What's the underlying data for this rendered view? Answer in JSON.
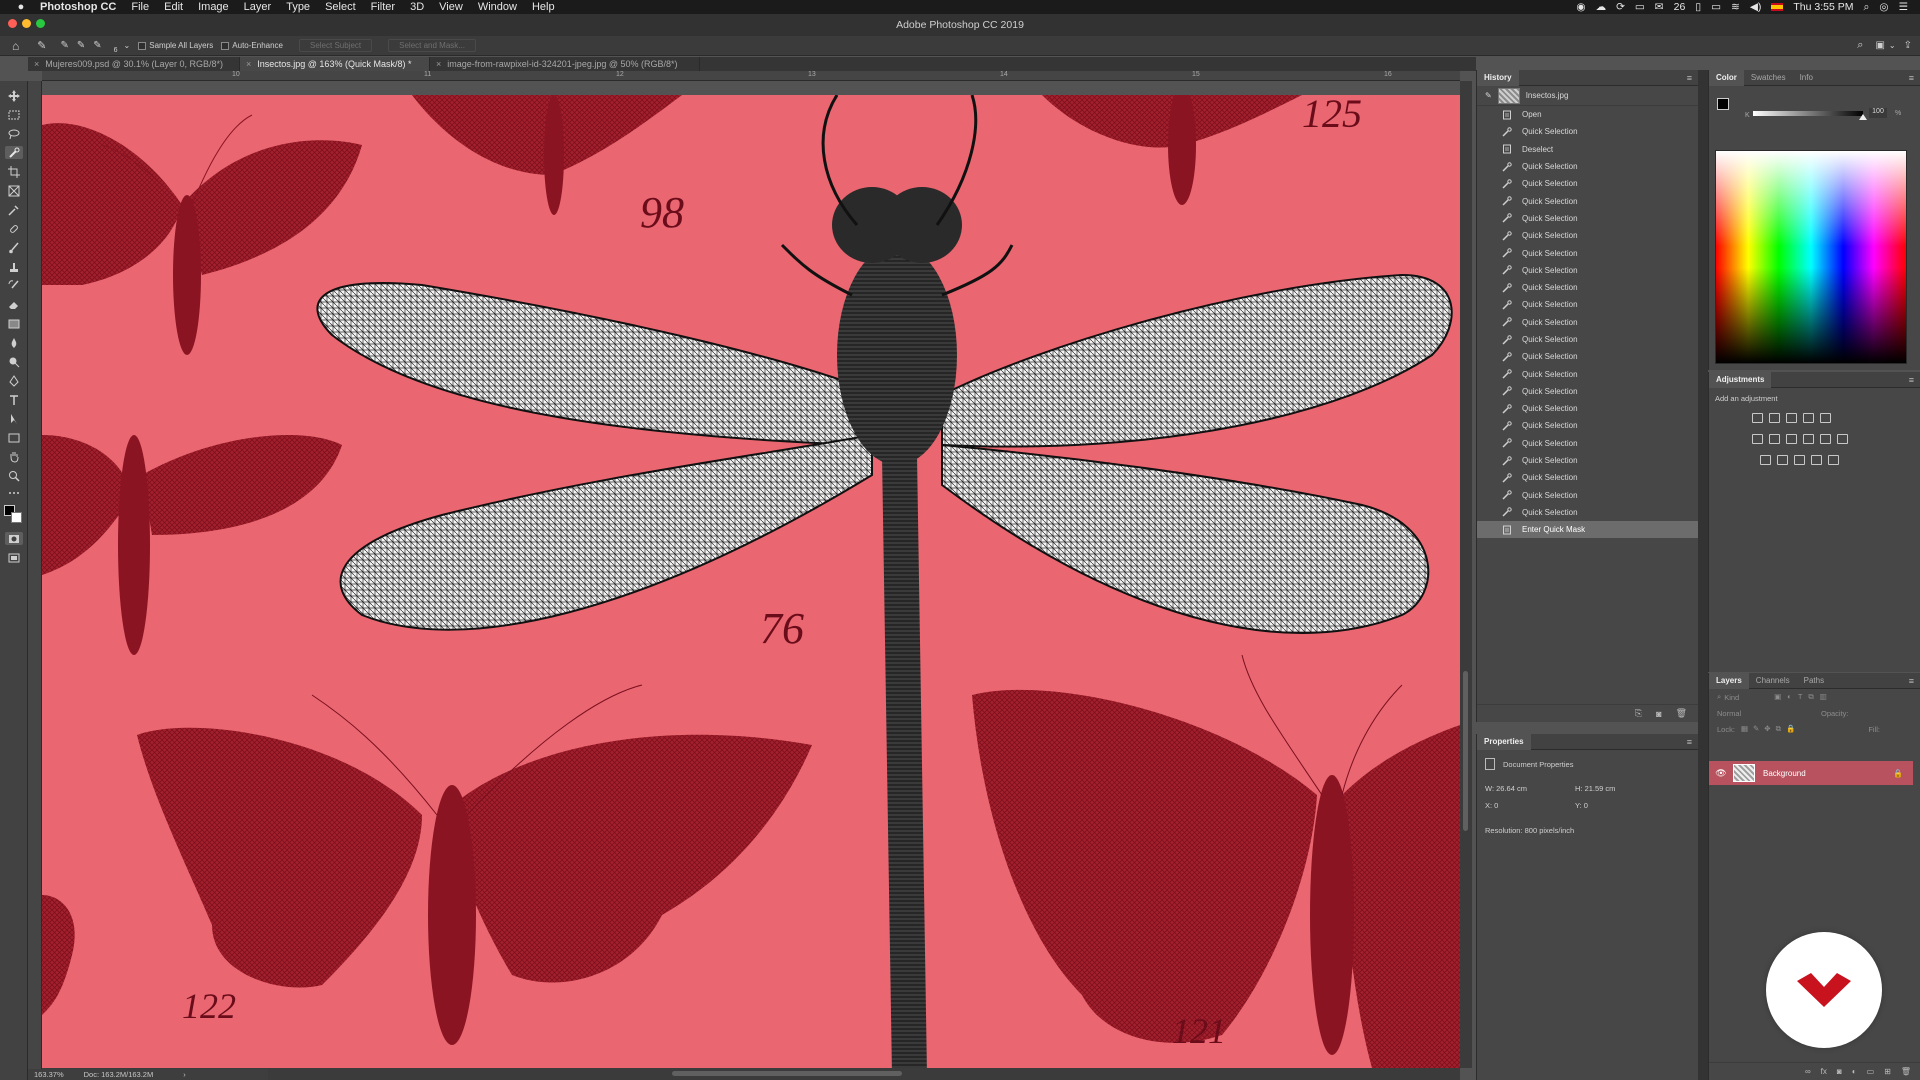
{
  "menubar": {
    "app_name": "Photoshop CC",
    "items": [
      "File",
      "Edit",
      "Image",
      "Layer",
      "Type",
      "Select",
      "Filter",
      "3D",
      "View",
      "Window",
      "Help"
    ],
    "notifications": "26",
    "clock": "Thu 3:55 PM"
  },
  "window": {
    "title": "Adobe Photoshop CC 2019"
  },
  "options": {
    "brush_size": "6",
    "sample_all_layers": "Sample All Layers",
    "auto_enhance": "Auto-Enhance",
    "select_subject": "Select Subject",
    "select_and_mask": "Select and Mask..."
  },
  "tabs": [
    {
      "label": "Mujeres009.psd @ 30.1% (Layer 0, RGB/8*)"
    },
    {
      "label": "Insectos.jpg @ 163% (Quick Mask/8) *"
    },
    {
      "label": "image-from-rawpixel-id-324201-jpeg.jpg @ 50% (RGB/8*)"
    }
  ],
  "ruler": [
    "10",
    "11",
    "12",
    "13",
    "14",
    "15",
    "16"
  ],
  "canvas": {
    "numbers": [
      "98",
      "125",
      "76",
      "122",
      "121"
    ],
    "mask_color": "#ea6670"
  },
  "status": {
    "zoom": "163.37%",
    "doc": "Doc: 163.2M/163.2M"
  },
  "history": {
    "title": "History",
    "snapshot": "Insectos.jpg",
    "items": [
      "Open",
      "Quick Selection",
      "Deselect",
      "Quick Selection",
      "Quick Selection",
      "Quick Selection",
      "Quick Selection",
      "Quick Selection",
      "Quick Selection",
      "Quick Selection",
      "Quick Selection",
      "Quick Selection",
      "Quick Selection",
      "Quick Selection",
      "Quick Selection",
      "Quick Selection",
      "Quick Selection",
      "Quick Selection",
      "Quick Selection",
      "Quick Selection",
      "Quick Selection",
      "Quick Selection",
      "Quick Selection",
      "Quick Selection",
      "Enter Quick Mask"
    ]
  },
  "properties": {
    "title": "Properties",
    "doc_props": "Document Properties",
    "w": "W: 26.64 cm",
    "h": "H: 21.59 cm",
    "x": "X: 0",
    "y": "Y: 0",
    "resolution": "Resolution: 800 pixels/inch"
  },
  "color_panel": {
    "tabs": [
      "Color",
      "Swatches",
      "Info"
    ],
    "value": "100",
    "unit": "%",
    "letter": "K"
  },
  "adjustments": {
    "title": "Adjustments",
    "hint": "Add an adjustment"
  },
  "layers": {
    "tabs": [
      "Layers",
      "Channels",
      "Paths"
    ],
    "kind": "Kind",
    "blend": "Normal",
    "opacity": "Opacity:",
    "lock": "Lock:",
    "fill": "Fill:",
    "layer_name": "Background"
  }
}
